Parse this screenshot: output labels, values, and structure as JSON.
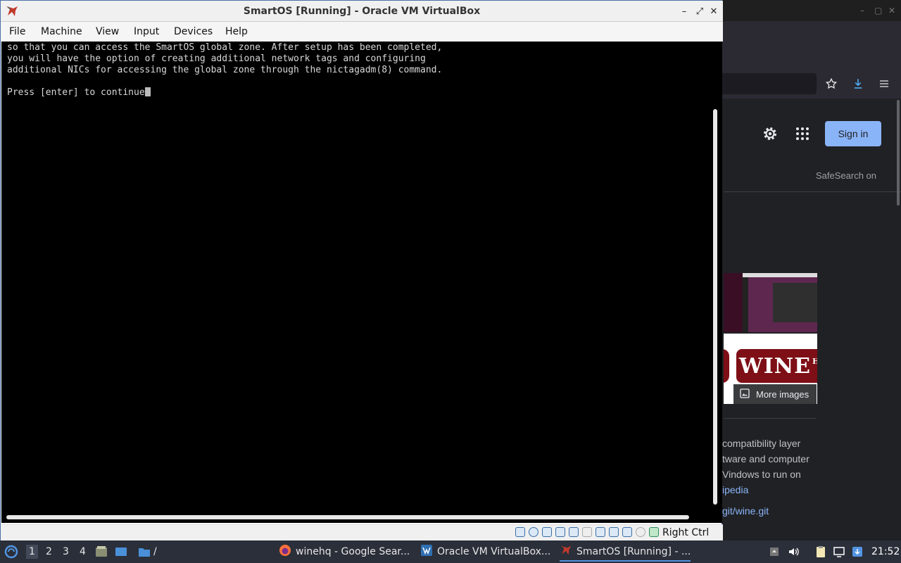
{
  "browser": {
    "signin_label": "Sign in",
    "safesearch_label": "SafeSearch on",
    "more_images_label": "More images",
    "wine_logo_text": "WINE",
    "wine_logo_sup": "HQ",
    "desc_lines": [
      "compatibility layer",
      "tware and computer",
      "Vindows to run on",
      "ipedia"
    ],
    "git_link": "git/wine.git"
  },
  "vbox": {
    "title": "SmartOS [Running] - Oracle VM VirtualBox",
    "menu": [
      "File",
      "Machine",
      "View",
      "Input",
      "Devices",
      "Help"
    ],
    "console_lines": [
      "so that you can access the SmartOS global zone. After setup has been completed,",
      "you will have the option of creating additional network tags and configuring",
      "additional NICs for accessing the global zone through the nictagadm(8) command.",
      "",
      "Press [enter] to continue"
    ],
    "host_key_label": "Right Ctrl"
  },
  "taskbar": {
    "workspaces": [
      "1",
      "2",
      "3",
      "4"
    ],
    "path_label": "/",
    "tasks": [
      {
        "label": "winehq - Google Sear...",
        "icon": "firefox-icon"
      },
      {
        "label": "Oracle VM VirtualBox...",
        "icon": "virtualbox-manager-icon"
      },
      {
        "label": "SmartOS [Running] - ...",
        "icon": "virtualbox-vm-icon"
      }
    ],
    "clock": "21:52"
  },
  "colors": {
    "accent": "#5294e2",
    "signin_bg": "#8ab4f8",
    "console_bg": "#000000",
    "taskbar_bg": "#2b2f3a"
  }
}
